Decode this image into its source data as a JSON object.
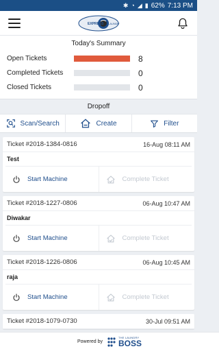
{
  "status_bar": {
    "battery": "62%",
    "time": "7:13 PM"
  },
  "app_bar": {
    "logo_text": "EXPRESS LAUNDRY"
  },
  "summary": {
    "title": "Today's Summary",
    "rows": [
      {
        "label": "Open Tickets",
        "count": "8",
        "fill_fraction": 1.0
      },
      {
        "label": "Completed Tickets",
        "count": "0",
        "fill_fraction": 0
      },
      {
        "label": "Closed Tickets",
        "count": "0",
        "fill_fraction": 0
      }
    ]
  },
  "section": {
    "title": "Dropoff"
  },
  "actions": {
    "scan_label": "Scan/Search",
    "create_label": "Create",
    "filter_label": "Filter"
  },
  "tickets": [
    {
      "number": "Ticket #2018-1384-0816",
      "date": "16-Aug 08:11 AM",
      "customer": "Test",
      "start_label": "Start Machine",
      "complete_label": "Complete Ticket"
    },
    {
      "number": "Ticket #2018-1227-0806",
      "date": "06-Aug 10:47 AM",
      "customer": "Diwakar",
      "start_label": "Start Machine",
      "complete_label": "Complete Ticket"
    },
    {
      "number": "Ticket #2018-1226-0806",
      "date": "06-Aug 10:45 AM",
      "customer": "raja",
      "start_label": "Start Machine",
      "complete_label": "Complete Ticket"
    },
    {
      "number": "Ticket #2018-1079-0730",
      "date": "30-Jul 09:51 AM",
      "customer": "",
      "start_label": "",
      "complete_label": ""
    }
  ],
  "footer": {
    "powered_by": "Powered by",
    "brand_small": "THE LAUNDRY",
    "brand_big": "BOSS"
  },
  "colors": {
    "status_bar": "#1b4f86",
    "accent": "#1f4e8c",
    "open_bar": "#e05a3c",
    "disabled": "#c3c9d1"
  }
}
